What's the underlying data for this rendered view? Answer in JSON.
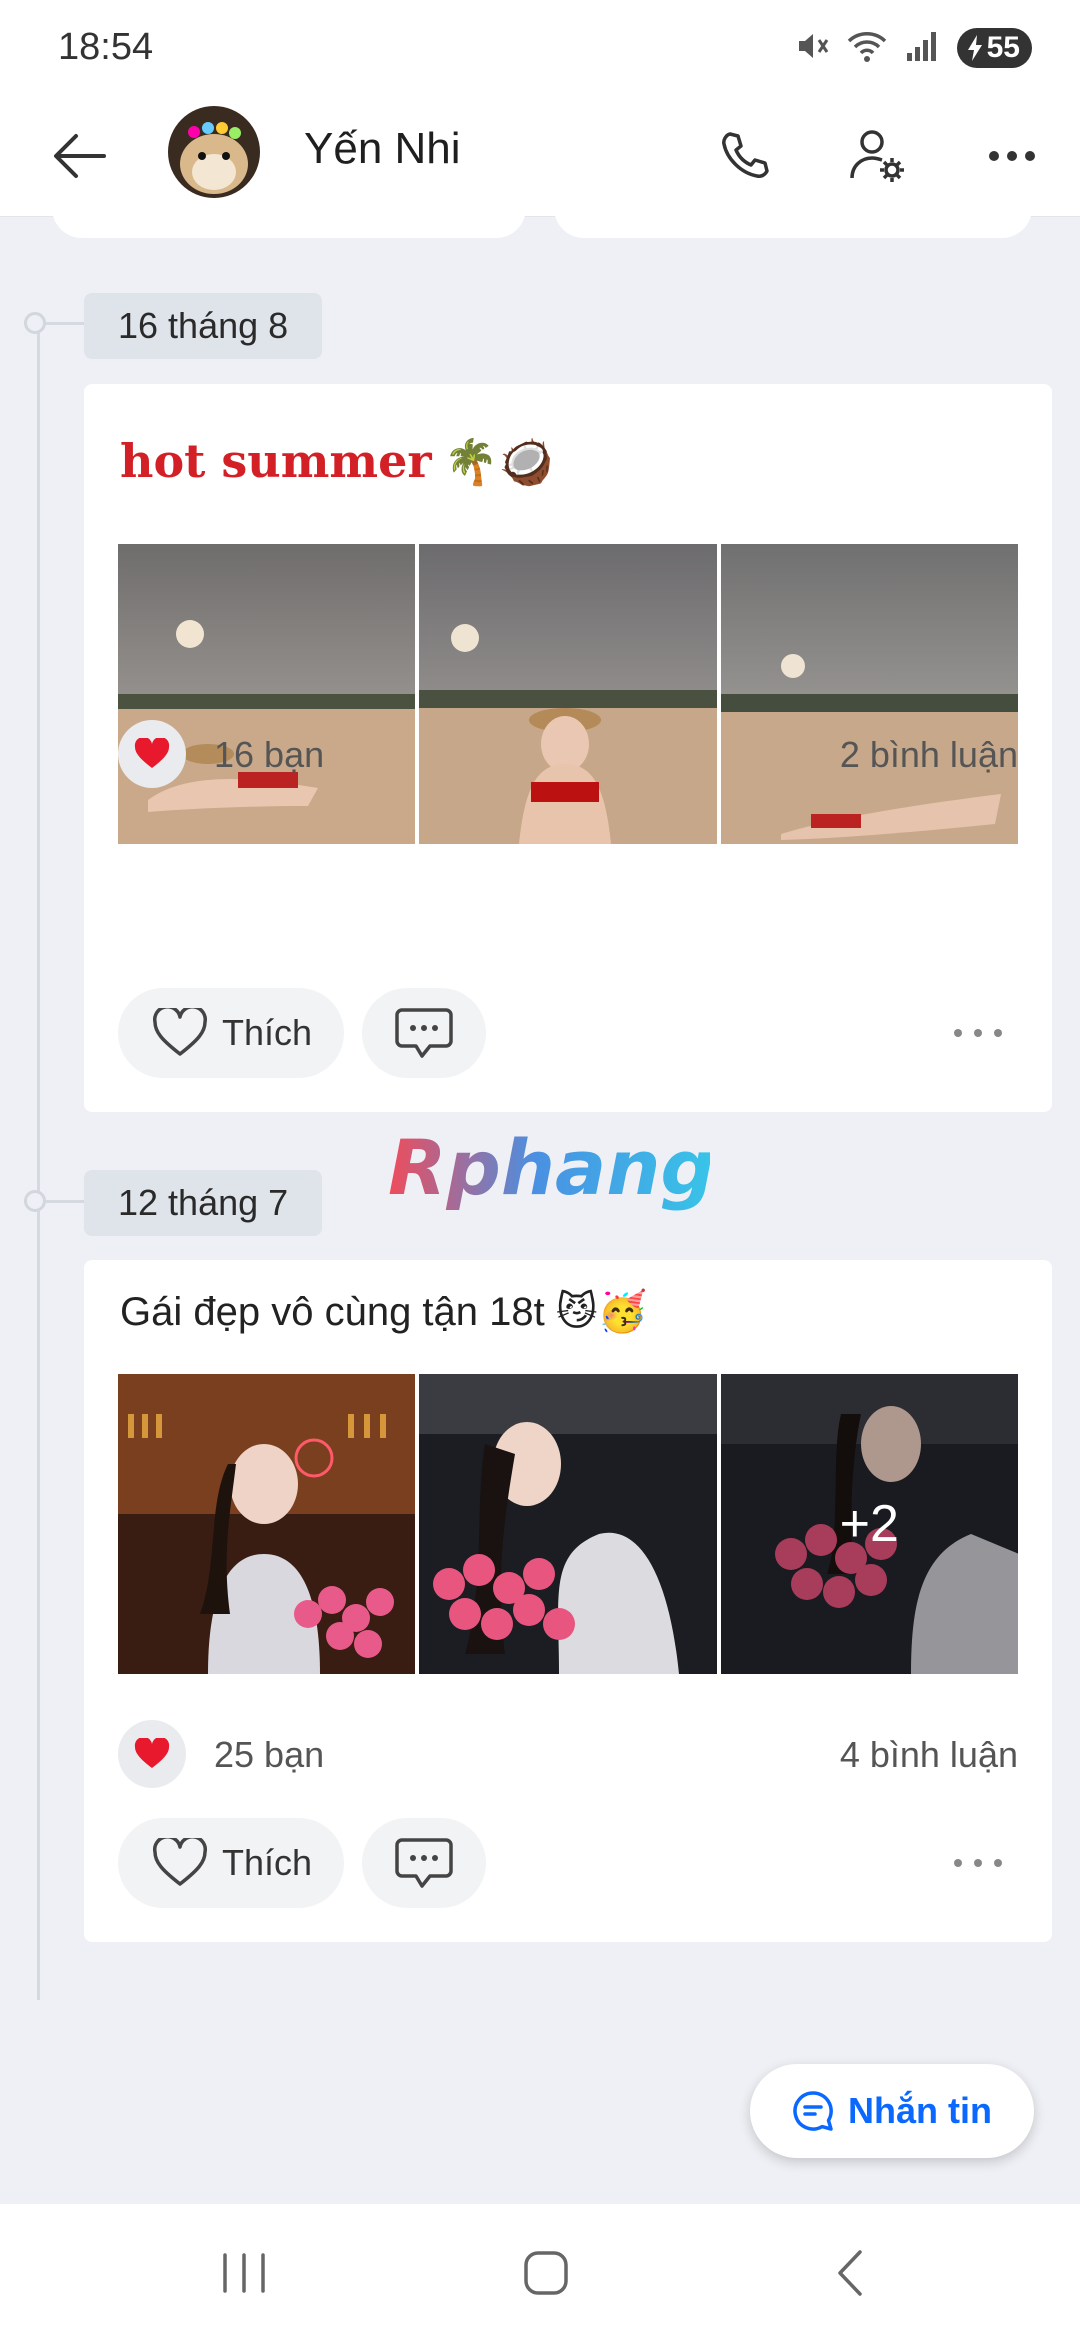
{
  "status_bar": {
    "time": "18:54",
    "battery": "55"
  },
  "header": {
    "name": "Yến Nhi"
  },
  "posts": [
    {
      "date": "16 tháng 8",
      "title": "hot summer",
      "title_emoji": "🌴🥥",
      "reaction_count": "16 bạn",
      "comment_count": "2 bình luận",
      "like_label": "Thích"
    },
    {
      "date": "12 tháng 7",
      "title": "Gái đẹp vô cùng tận 18t",
      "title_emoji": "😼🥳",
      "reaction_count": "25 bạn",
      "comment_count": "4 bình luận",
      "like_label": "Thích",
      "more_photos": "+2"
    }
  ],
  "watermark": "Rphang",
  "fab": {
    "label": "Nhắn tin"
  },
  "colors": {
    "accent": "#0a68ff",
    "title_red": "#d32026",
    "heart": "#e8192c"
  }
}
